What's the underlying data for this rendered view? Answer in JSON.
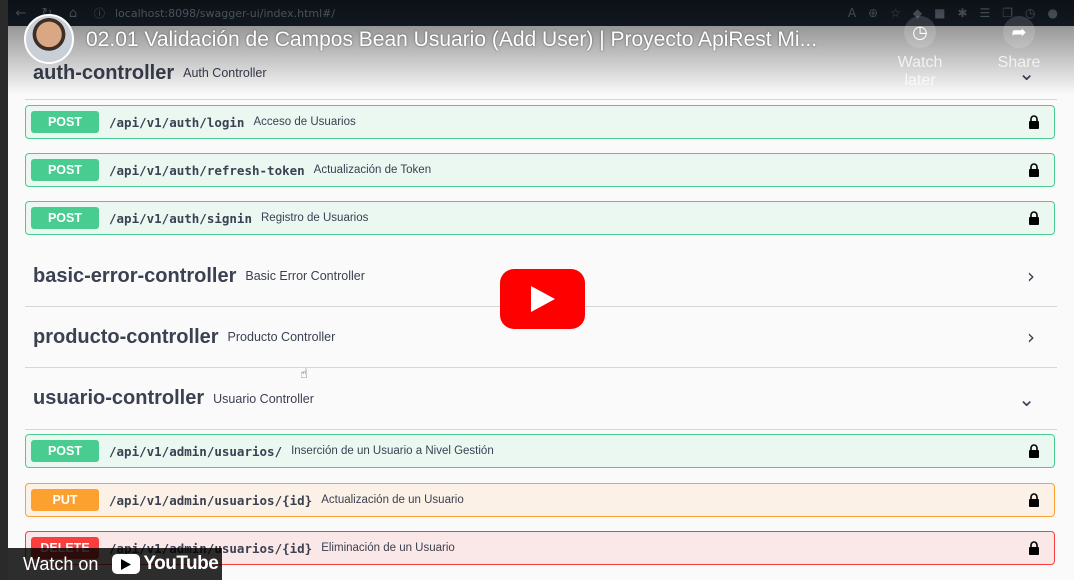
{
  "browser": {
    "url": "localhost:8098/swagger-ui/index.html#/",
    "nav_icons": [
      "back-icon",
      "refresh-icon",
      "home-icon"
    ]
  },
  "youtube": {
    "title": "02.01 Validación de Campos Bean Usuario (Add User) | Proyecto ApiRest Mi...",
    "watch_later": "Watch later",
    "share": "Share",
    "watch_on": "Watch on",
    "brand": "YouTube"
  },
  "controllers": [
    {
      "name": "auth-controller",
      "desc": "Auth Controller",
      "expanded": true
    },
    {
      "name": "basic-error-controller",
      "desc": "Basic Error Controller",
      "expanded": false
    },
    {
      "name": "producto-controller",
      "desc": "Producto Controller",
      "expanded": false
    },
    {
      "name": "usuario-controller",
      "desc": "Usuario Controller",
      "expanded": true
    }
  ],
  "auth_ops": [
    {
      "method": "POST",
      "path": "/api/v1/auth/login",
      "summary": "Acceso de Usuarios"
    },
    {
      "method": "POST",
      "path": "/api/v1/auth/refresh-token",
      "summary": "Actualización de Token"
    },
    {
      "method": "POST",
      "path": "/api/v1/auth/signin",
      "summary": "Registro de Usuarios"
    }
  ],
  "usuario_ops": [
    {
      "method": "POST",
      "path": "/api/v1/admin/usuarios/",
      "summary": "Inserción de un Usuario a Nivel Gestión"
    },
    {
      "method": "PUT",
      "path": "/api/v1/admin/usuarios/{id}",
      "summary": "Actualización de un Usuario"
    },
    {
      "method": "DELETE",
      "path": "/api/v1/admin/usuarios/{id}",
      "summary": "Eliminación de un Usuario"
    }
  ],
  "colors": {
    "post": "#49cc90",
    "put": "#fca130",
    "delete": "#f93e3e",
    "youtube_red": "#ff0000"
  }
}
